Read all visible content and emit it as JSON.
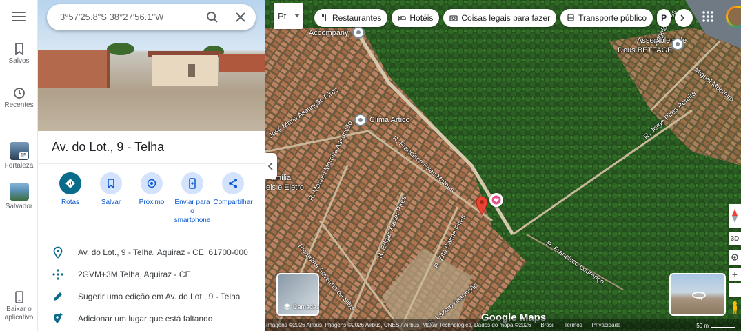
{
  "rail": {
    "items": [
      {
        "label": "Salvos"
      },
      {
        "label": "Recentes"
      },
      {
        "label": "Fortaleza",
        "badge": "15"
      },
      {
        "label": "Salvador"
      },
      {
        "label": "Baixar o aplicativo"
      }
    ]
  },
  "search": {
    "value": "3°57'25.8\"S 38°27'56.1\"W"
  },
  "place": {
    "title": "Av. do Lot., 9 - Telha"
  },
  "actions": [
    {
      "label": "Rotas",
      "icon": "directions-icon"
    },
    {
      "label": "Salvar",
      "icon": "bookmark-icon"
    },
    {
      "label": "Próximo",
      "icon": "nearby-icon"
    },
    {
      "label": "Enviar para o smartphone",
      "icon": "send-to-phone-icon"
    },
    {
      "label": "Compartilhar",
      "icon": "share-icon"
    }
  ],
  "info": [
    {
      "text": "Av. do Lot., 9 - Telha, Aquiraz - CE, 61700-000",
      "icon": "location-pin-icon"
    },
    {
      "text": "2GVM+3M Telha, Aquiraz - CE",
      "icon": "plus-code-icon"
    },
    {
      "text": "Sugerir uma edição em Av. do Lot., 9 - Telha",
      "icon": "pencil-icon"
    },
    {
      "text": "Adicionar um lugar que está faltando",
      "icon": "add-place-icon"
    }
  ],
  "map": {
    "layer_toggle": "Pt",
    "chips": [
      {
        "label": "Restaurantes",
        "icon": "fork-knife-icon"
      },
      {
        "label": "Hotéis",
        "icon": "bed-icon"
      },
      {
        "label": "Coisas legais para fazer",
        "icon": "camera-icon"
      },
      {
        "label": "Transporte público",
        "icon": "bus-icon"
      },
      {
        "label": "P",
        "icon": ""
      }
    ],
    "places": [
      {
        "name": "Accompany"
      },
      {
        "name": "Clima Artico"
      },
      {
        "name": "Assembleia de"
      },
      {
        "name": "Deus BETFAGE"
      },
      {
        "name": "Família"
      },
      {
        "name": "eis e Eletro"
      }
    ],
    "roads": [
      "José Maria Assunção Pires",
      "R. Francisco Pires Mateus",
      "R. Manuel Moreira Assunção",
      "R. Edgar Xavier Pires",
      "R. Zita Balma Pires",
      "Ricardina Severina da Silva",
      "R. Lázaro Assunção",
      "R. Francisco Lourenço",
      "R. Jorge Pires Pereira",
      "Ângelo Pires",
      "Miguel Monteiro"
    ],
    "layers_label": "Camadas",
    "logo": "Google Maps",
    "footer": {
      "attribution": "Imagens ©2026 Airbus, Imagens ©2026 Airbus, CNES / Airbus, Maxar Technologies, Dados do mapa ©2026",
      "country": "Brasil",
      "terms": "Termos",
      "privacy": "Privacidade",
      "scale": "50 m"
    },
    "controls_3d": "3D"
  }
}
